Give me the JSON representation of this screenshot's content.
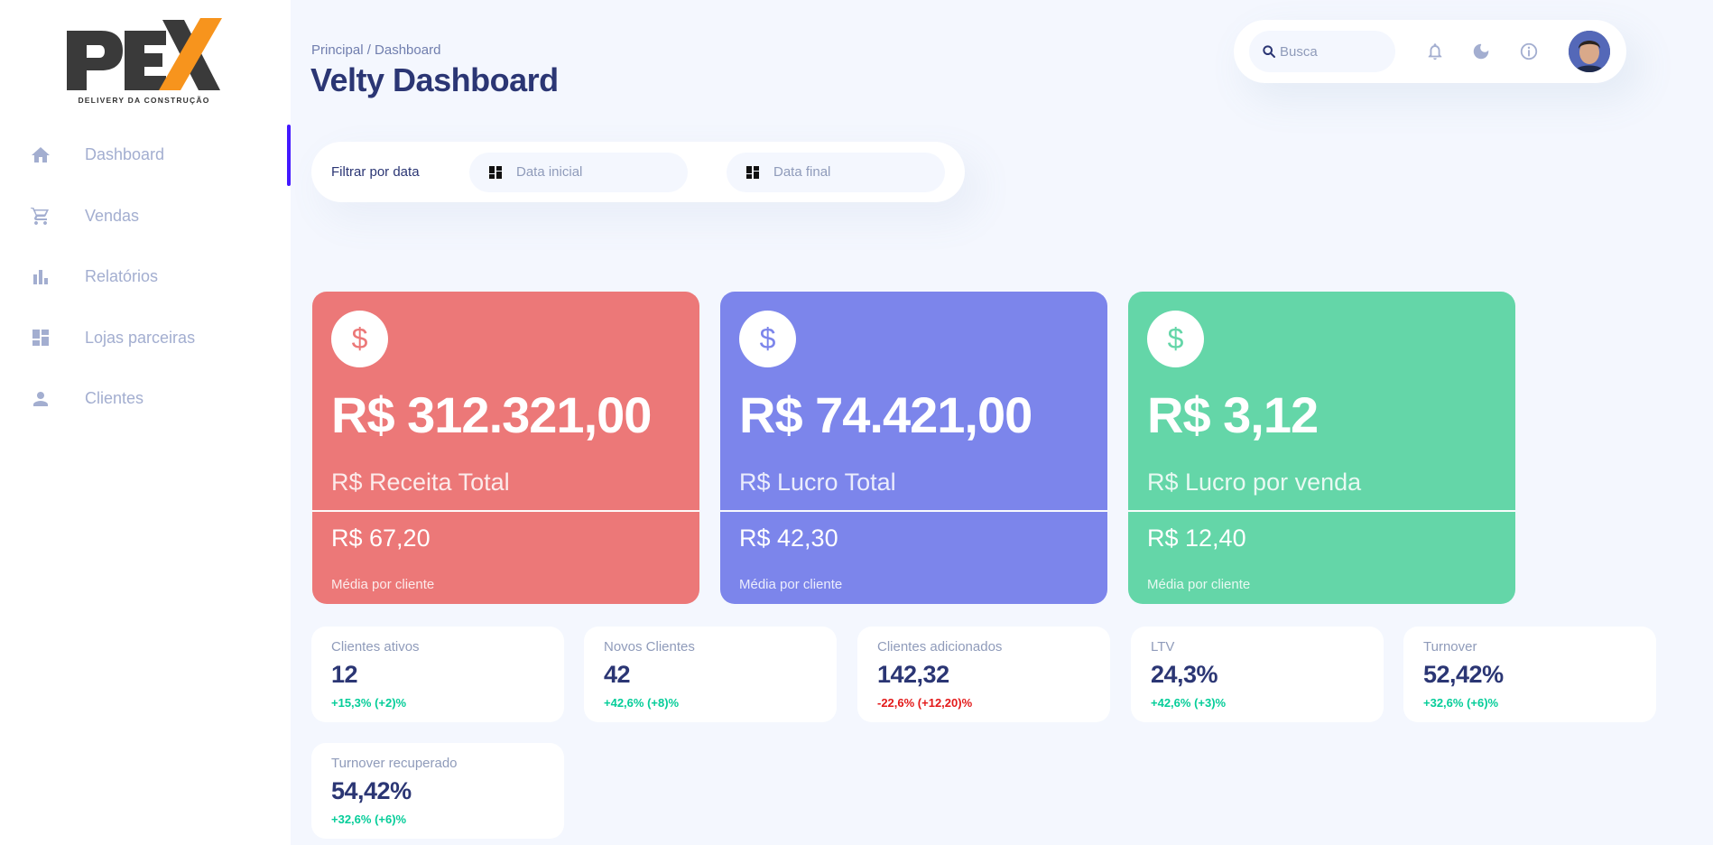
{
  "brand": {
    "logo_text": "PEX",
    "tagline": "DELIVERY DA CONSTRUÇÃO",
    "logo_dark": "#3A3A3A",
    "logo_accent": "#F7941D"
  },
  "sidebar": {
    "items": [
      {
        "label": "Dashboard",
        "icon": "home-icon",
        "active": true
      },
      {
        "label": "Vendas",
        "icon": "cart-icon",
        "active": false
      },
      {
        "label": "Relatórios",
        "icon": "bar-chart-icon",
        "active": false
      },
      {
        "label": "Lojas parceiras",
        "icon": "dashboard-grid-icon",
        "active": false
      },
      {
        "label": "Clientes",
        "icon": "person-icon",
        "active": false
      }
    ],
    "active_color": "#4318FF"
  },
  "header": {
    "breadcrumb": "Principal / Dashboard",
    "title": "Velty Dashboard"
  },
  "topbar": {
    "search_placeholder": "Busca",
    "icons": [
      "bell-icon",
      "moon-icon",
      "info-icon"
    ]
  },
  "filter": {
    "label": "Filtrar por data",
    "start_placeholder": "Data inicial",
    "end_placeholder": "Data final"
  },
  "cards": [
    {
      "amount": "R$ 312.321,00",
      "title": "R$ Receita Total",
      "avg": "R$ 67,20",
      "avg_label": "Média por cliente",
      "color": "#EC7878",
      "icon": "dollar-icon"
    },
    {
      "amount": "R$ 74.421,00",
      "title": "R$ Lucro Total",
      "avg": "R$ 42,30",
      "avg_label": "Média por cliente",
      "color": "#7C85EB",
      "icon": "dollar-icon"
    },
    {
      "amount": "R$ 3,12",
      "title": "R$ Lucro por venda",
      "avg": "R$ 12,40",
      "avg_label": "Média por cliente",
      "color": "#64D6A8",
      "icon": "dollar-icon"
    }
  ],
  "stats": [
    {
      "label": "Clientes ativos",
      "value": "12",
      "change": "+15,3% (+2)%",
      "trend": "up"
    },
    {
      "label": "Novos Clientes",
      "value": "42",
      "change": "+42,6% (+8)%",
      "trend": "up"
    },
    {
      "label": "Clientes adicionados",
      "value": "142,32",
      "change": "-22,6% (+12,20)%",
      "trend": "down"
    },
    {
      "label": "LTV",
      "value": "24,3%",
      "change": "+42,6% (+3)%",
      "trend": "up"
    },
    {
      "label": "Turnover",
      "value": "52,42%",
      "change": "+32,6% (+6)%",
      "trend": "up"
    },
    {
      "label": "Turnover recuperado",
      "value": "54,42%",
      "change": "+32,6% (+6)%",
      "trend": "up"
    }
  ],
  "colors": {
    "positive": "#05CD99",
    "negative": "#E31A1A",
    "text_primary": "#2B3674",
    "text_secondary": "#A3AED0"
  }
}
